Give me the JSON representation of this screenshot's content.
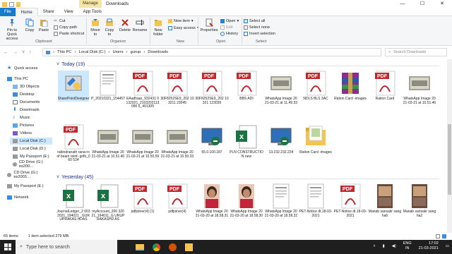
{
  "window": {
    "title": "Downloads",
    "manage_label": "Manage"
  },
  "titlebar_controls": [
    "—",
    "☐",
    "✕"
  ],
  "tabs": [
    "File",
    "Home",
    "Share",
    "View",
    "App Tools"
  ],
  "ribbon": {
    "pin": "Pin to Quick access",
    "copy": "Copy",
    "paste": "Paste",
    "cut": "Cut",
    "copy_path": "Copy path",
    "paste_shortcut": "Paste shortcut",
    "move_to": "Move to",
    "copy_to": "Copy to",
    "delete": "Delete",
    "rename": "Rename",
    "new_folder": "New folder",
    "new_item": "New item",
    "easy_access": "Easy access",
    "properties": "Properties",
    "open": "Open",
    "edit": "Edit",
    "history": "History",
    "select_all": "Select all",
    "select_none": "Select none",
    "invert_selection": "Invert selection",
    "groups": {
      "clipboard": "Clipboard",
      "organize": "Organize",
      "new": "New",
      "open": "Open",
      "select": "Select"
    }
  },
  "address": {
    "crumbs": [
      "This PC",
      "Local Disk (C:)",
      "Users",
      "gurup",
      "Downloads"
    ],
    "search_placeholder": "Search Downloads"
  },
  "nav": {
    "quick_access": "Quick access",
    "this_pc": "This PC",
    "items": [
      "3D Objects",
      "Desktop",
      "Documents",
      "Downloads",
      "Music",
      "Pictures",
      "Videos",
      "Local Disk (C:)",
      "Local Disk (D:)",
      "My Passport (E:)",
      "CD Drive (G:) es200…"
    ],
    "cd_drive": "CD Drive (G:) es2003…",
    "my_passport": "My Passport (E:)",
    "network": "Network"
  },
  "groups": {
    "today": "Today (19)",
    "yesterday": "Yesterday (45)"
  },
  "today_row1": [
    {
      "name": "SharePointDesigner",
      "kind": "installer"
    },
    {
      "name": "P_20210321_154457",
      "kind": "doc"
    },
    {
      "name": "EAadhaar_932431 0132021_2103202113090 6_401305",
      "kind": "pdf"
    },
    {
      "name": "30F8252SE9_202 103211 23045",
      "kind": "pdf"
    },
    {
      "name": "30F8252SE9_202 10321 123039",
      "kind": "pdf"
    },
    {
      "name": "BBS ADI",
      "kind": "pdf"
    },
    {
      "name": "WhatsApp Image 2021-03-21 at 11.49.33",
      "kind": "photo"
    },
    {
      "name": "NDLS BLS 3AC",
      "kind": "pdf"
    },
    {
      "name": "Ration Card -images",
      "kind": "rar"
    },
    {
      "name": "Ration Card",
      "kind": "pdf"
    },
    {
      "name": "WhatsApp Image 2021-03-21 at 10.51.46",
      "kind": "photo"
    }
  ],
  "today_row2": [
    {
      "name": "rabindranath rana-roof beam reinf- grifk_060 524",
      "kind": "pdf"
    },
    {
      "name": "WhatsApp Image 2021-03-21 at 10.51.40",
      "kind": "photo"
    },
    {
      "name": "WhatsApp Image 2021-03-21 at 10.50.59",
      "kind": "photo"
    },
    {
      "name": "WhatsApp Image 2021-03-21 at 10.50.33",
      "kind": "photo"
    },
    {
      "name": "65.0.100.187",
      "kind": "rdp"
    },
    {
      "name": "PLN CONSTRUCTION new",
      "kind": "excel"
    },
    {
      "name": "13.232.232.234",
      "kind": "rdp"
    },
    {
      "name": "Ration Card -images",
      "kind": "folder"
    }
  ],
  "yesterday_row": [
    {
      "name": "JournalLedger_2 0032021_194021 _GURUPRAKAS HDAS",
      "kind": "excel"
    },
    {
      "name": "myAccount_200 32021_194011_G URUPRAKASHD AS",
      "kind": "excel"
    },
    {
      "name": "pdfjoiner(4) (1)",
      "kind": "pdf"
    },
    {
      "name": "pdfjoiner(4)",
      "kind": "pdf"
    },
    {
      "name": "WhatsApp Image 2021-03-20 at 18.58.31",
      "kind": "portrait"
    },
    {
      "name": "WhatsApp Image 2021-03-20 at 18.58.30",
      "kind": "portrait"
    },
    {
      "name": "WhatsApp Image 2021-03-20 at 18.58.32",
      "kind": "doc"
    },
    {
      "name": "PET-Notice dt.18-03-2021",
      "kind": "doc"
    },
    {
      "name": "PET-Notice dt.18-03-2021",
      "kind": "pdf"
    },
    {
      "name": "Manab sansakr sangha6",
      "kind": "photo2"
    },
    {
      "name": "Manab sansakr sangha2",
      "kind": "photo2"
    }
  ],
  "status": {
    "count": "65 items",
    "selected": "1 item selected 279 MB"
  },
  "taskbar": {
    "search": "Type here to search",
    "lang": "ENG\nIN",
    "time": "17:02",
    "date": "21-03-2021"
  },
  "colors": {
    "accent": "#1979ca",
    "pdf": "#c0282d",
    "excel": "#1d7244",
    "selection": "#cce8ff"
  }
}
